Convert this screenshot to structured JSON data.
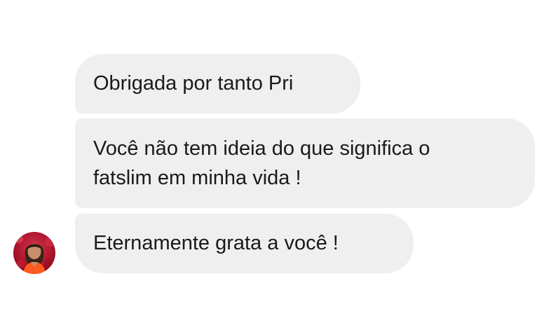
{
  "messages": [
    {
      "text": "Obrigada por tanto Pri"
    },
    {
      "text": "Você não tem ideia do que significa o\nfatslim em minha vida !"
    },
    {
      "text": "Eternamente grata a você !"
    }
  ],
  "colors": {
    "background": "#ffffff",
    "bubble": "#efefef",
    "text": "#1a1a1a"
  },
  "sender": {
    "avatar_icon": "profile-photo"
  }
}
